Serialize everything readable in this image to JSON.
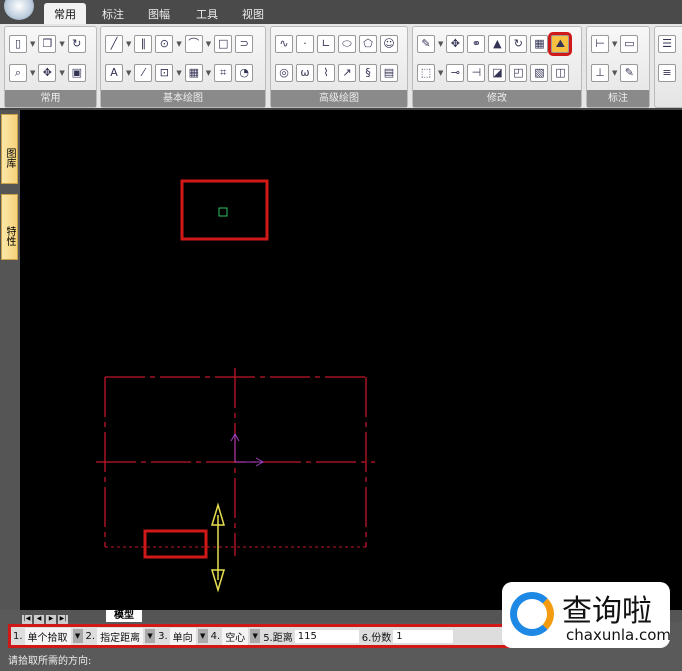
{
  "tabs": [
    "常用",
    "标注",
    "图幅",
    "工具",
    "视图"
  ],
  "active_tab": "常用",
  "ribbon_groups": [
    "常用",
    "基本绘图",
    "高级绘图",
    "修改",
    "标注"
  ],
  "side_panels": [
    "图库",
    "特性"
  ],
  "model_tab": "模型",
  "command_bar": {
    "opt1_label": "1.",
    "opt1_value": "单个拾取",
    "opt2_label": "2.",
    "opt2_value": "指定距离",
    "opt3_label": "3.",
    "opt3_value": "单向",
    "opt4_label": "4.",
    "opt4_value": "空心",
    "opt5_label": "5.距离",
    "opt5_value": "115",
    "opt6_label": "6.份数",
    "opt6_value": "1"
  },
  "prompt": "请拾取所需的方向:",
  "watermark": {
    "text": "查询啦",
    "url": "chaxunla.com"
  },
  "colors": {
    "highlight": "#d01818",
    "drawing": "#c0162a",
    "axis": "#a040c0",
    "arrow": "#e8e050",
    "point": "#30c060"
  }
}
